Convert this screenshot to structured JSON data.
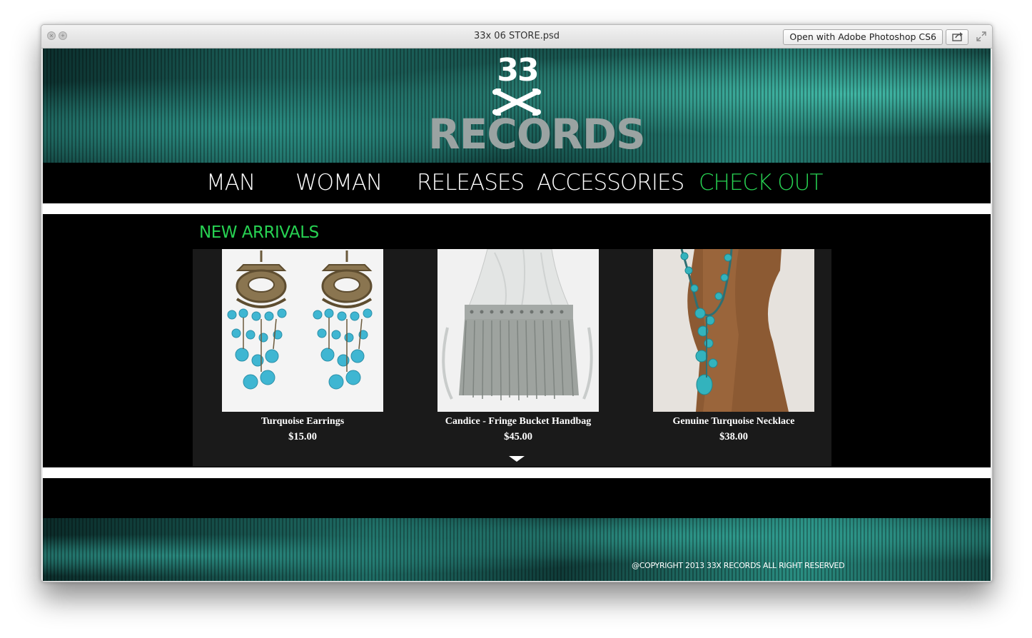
{
  "window": {
    "title": "33x 06 STORE.psd",
    "open_with_label": "Open with Adobe Photoshop CS6",
    "close_icon": "close-icon",
    "zoom_icon": "zoom-icon",
    "share_icon": "share-icon",
    "expand_icon": "expand-icon"
  },
  "brand": {
    "logo_top": "33",
    "logo_bottom": "RECORDS",
    "logo_icon": "crossbones-icon"
  },
  "nav": {
    "items": [
      {
        "label": "MAN"
      },
      {
        "label": "WOMAN"
      },
      {
        "label": "RELEASES"
      },
      {
        "label": "ACCESSORIES"
      },
      {
        "label": "CHECK OUT",
        "active": true
      }
    ]
  },
  "section": {
    "title": "NEW ARRIVALS"
  },
  "products": [
    {
      "name": "Turquoise Earrings",
      "price": "$15.00",
      "image": "turquoise-earrings-photo"
    },
    {
      "name": "Candice - Fringe Bucket Handbag",
      "price": "$45.00",
      "image": "fringe-bucket-handbag-photo"
    },
    {
      "name": "Genuine Turquoise Necklace",
      "price": "$38.00",
      "image": "turquoise-necklace-photo"
    }
  ],
  "more_icon": "chevron-down-icon",
  "footer": {
    "copyright": "@COPYRIGHT 2013 33X RECORDS ALL RIGHT RESERVED"
  },
  "colors": {
    "accent_green": "#27d152",
    "teal": "#1e6a63",
    "background": "#000000"
  }
}
